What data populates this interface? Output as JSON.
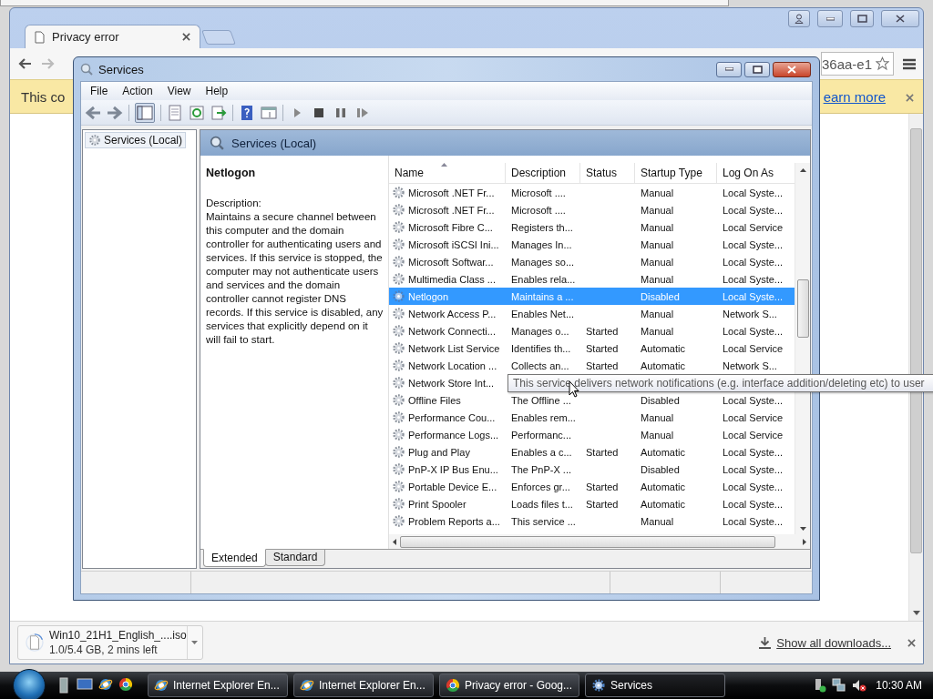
{
  "browser": {
    "tabs": [
      {
        "title": "Privacy error",
        "selected": true
      }
    ],
    "address_fragment": "36aa-e1",
    "infobar": {
      "text": "This co",
      "link": "earn more"
    },
    "download": {
      "file_name": "Win10_21H1_English_....iso",
      "progress": "1.0/5.4 GB, 2 mins left",
      "level": 0.19,
      "show_all": "Show all downloads..."
    }
  },
  "services_window": {
    "title": "Services",
    "menu": [
      "File",
      "Action",
      "View",
      "Help"
    ],
    "tree": [
      {
        "label": "Services (Local)",
        "selected": true
      }
    ],
    "header": "Services (Local)",
    "details": {
      "name": "Netlogon",
      "label": "Description:",
      "text": "Maintains a secure channel between this computer and the domain controller for authenticating users and services. If this service is stopped, the computer may not authenticate users and services and the domain controller cannot register DNS records. If this service is disabled, any services that explicitly depend on it will fail to start."
    },
    "columns": [
      {
        "label": "Name",
        "sorted": true
      },
      {
        "label": "Description",
        "sorted": false
      },
      {
        "label": "Status",
        "sorted": false
      },
      {
        "label": "Startup Type",
        "sorted": false
      },
      {
        "label": "Log On As",
        "sorted": false
      }
    ],
    "rows": [
      {
        "name": "Microsoft .NET Fr...",
        "description": "Microsoft ....",
        "startup_type": "Manual",
        "log_on_as": "Local Syste...",
        "selected": false
      },
      {
        "name": "Microsoft .NET Fr...",
        "description": "Microsoft ....",
        "startup_type": "Manual",
        "log_on_as": "Local Syste...",
        "selected": false
      },
      {
        "name": "Microsoft Fibre C...",
        "description": "Registers th...",
        "startup_type": "Manual",
        "log_on_as": "Local Service",
        "selected": false
      },
      {
        "name": "Microsoft iSCSI Ini...",
        "description": "Manages In...",
        "startup_type": "Manual",
        "log_on_as": "Local Syste...",
        "selected": false
      },
      {
        "name": "Microsoft Softwar...",
        "description": "Manages so...",
        "startup_type": "Manual",
        "log_on_as": "Local Syste...",
        "selected": false
      },
      {
        "name": "Multimedia Class ...",
        "description": "Enables rela...",
        "startup_type": "Manual",
        "log_on_as": "Local Syste...",
        "selected": false
      },
      {
        "name": "Netlogon",
        "description": "Maintains a ...",
        "startup_type": "Disabled",
        "log_on_as": "Local Syste...",
        "selected": true
      },
      {
        "name": "Network Access P...",
        "description": "Enables Net...",
        "startup_type": "Manual",
        "log_on_as": "Network S...",
        "selected": false
      },
      {
        "name": "Network Connecti...",
        "description": "Manages o...",
        "status": "Started",
        "startup_type": "Manual",
        "log_on_as": "Local Syste...",
        "selected": false
      },
      {
        "name": "Network List Service",
        "description": "Identifies th...",
        "status": "Started",
        "startup_type": "Automatic",
        "log_on_as": "Local Service",
        "selected": false
      },
      {
        "name": "Network Location ...",
        "description": "Collects an...",
        "status": "Started",
        "startup_type": "Automatic",
        "log_on_as": "Network S...",
        "selected": false
      },
      {
        "name": "Network Store Int...",
        "selected": false
      },
      {
        "name": "Offline Files",
        "description": "The Offline ...",
        "startup_type": "Disabled",
        "log_on_as": "Local Syste...",
        "selected": false
      },
      {
        "name": "Performance Cou...",
        "description": "Enables rem...",
        "startup_type": "Manual",
        "log_on_as": "Local Service",
        "selected": false
      },
      {
        "name": "Performance Logs...",
        "description": "Performanc...",
        "startup_type": "Manual",
        "log_on_as": "Local Service",
        "selected": false
      },
      {
        "name": "Plug and Play",
        "description": "Enables a c...",
        "status": "Started",
        "startup_type": "Automatic",
        "log_on_as": "Local Syste...",
        "selected": false
      },
      {
        "name": "PnP-X IP Bus Enu...",
        "description": "The PnP-X ...",
        "startup_type": "Disabled",
        "log_on_as": "Local Syste...",
        "selected": false
      },
      {
        "name": "Portable Device E...",
        "description": "Enforces gr...",
        "status": "Started",
        "startup_type": "Automatic",
        "log_on_as": "Local Syste...",
        "selected": false
      },
      {
        "name": "Print Spooler",
        "description": "Loads files t...",
        "status": "Started",
        "startup_type": "Automatic",
        "log_on_as": "Local Syste...",
        "selected": false
      },
      {
        "name": "Problem Reports a...",
        "description": "This service ...",
        "startup_type": "Manual",
        "log_on_as": "Local Syste...",
        "selected": false
      }
    ],
    "view_tabs": [
      {
        "label": "Extended",
        "selected": true
      },
      {
        "label": "Standard",
        "selected": false
      }
    ]
  },
  "tooltip": "This service delivers network notifications (e.g. interface addition/deleting etc) to user",
  "taskbar": {
    "items": [
      {
        "label": "Internet Explorer En...",
        "kind": "ie",
        "selected": false
      },
      {
        "label": "Internet Explorer En...",
        "kind": "ie",
        "selected": false
      },
      {
        "label": "Privacy error - Goog...",
        "kind": "chrome",
        "selected": false
      },
      {
        "label": "Services",
        "kind": "gear",
        "selected": true
      }
    ],
    "clock": "10:30 AM"
  }
}
